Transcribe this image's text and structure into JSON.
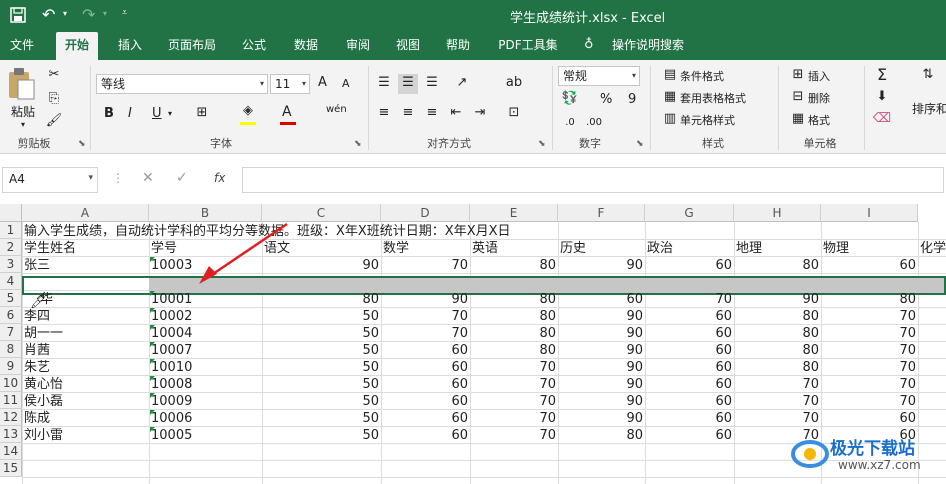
{
  "titlebar": {
    "title": "学生成绩统计.xlsx  -  Excel",
    "quick_access": {
      "save": "save-icon",
      "undo": "undo-icon",
      "redo": "redo-icon",
      "customize": "customize-icon"
    },
    "brand_color": "#217346"
  },
  "tabs": [
    "文件",
    "开始",
    "插入",
    "页面布局",
    "公式",
    "数据",
    "审阅",
    "视图",
    "帮助",
    "PDF工具集",
    "操作说明搜索"
  ],
  "ribbon": {
    "clipboard": {
      "label": "剪贴板",
      "paste": "粘贴"
    },
    "font": {
      "label": "字体",
      "font_name": "等线",
      "font_size": "11",
      "bold": "B",
      "italic": "I",
      "underline": "U",
      "grow": "A",
      "shrink": "A",
      "phonetic": "wén"
    },
    "alignment": {
      "label": "对齐方式"
    },
    "number": {
      "label": "数字",
      "format": "常规",
      "percent": "%",
      "comma": "9"
    },
    "styles": {
      "label": "样式",
      "conditional": "条件格式",
      "table": "套用表格格式",
      "cell_styles": "单元格样式"
    },
    "cells": {
      "label": "单元格",
      "insert": "插入",
      "delete": "删除",
      "format": "格式"
    },
    "editing": {
      "sort": "排序和"
    }
  },
  "formula_bar": {
    "name_box": "A4",
    "fx": "fx",
    "content": ""
  },
  "columns": [
    "A",
    "B",
    "C",
    "D",
    "E",
    "F",
    "G",
    "H",
    "I"
  ],
  "rows": [
    "1",
    "2",
    "3",
    "4",
    "5",
    "6",
    "7",
    "8",
    "9",
    "10",
    "11",
    "12",
    "13",
    "14",
    "15"
  ],
  "sheet": {
    "row1": "输入学生成绩，自动统计学科的平均分等数据。班级：X年X班统计日期：X年X月X日",
    "headers": [
      "学生姓名",
      "学号",
      "语文",
      "数学",
      "英语",
      "历史",
      "政治",
      "地理",
      "物理",
      "化学"
    ],
    "records": [
      {
        "name": "张三",
        "id": "10003",
        "scores": [
          "90",
          "70",
          "80",
          "90",
          "60",
          "80",
          "60"
        ]
      },
      {
        "name": "华",
        "id": "10001",
        "scores": [
          "80",
          "90",
          "80",
          "60",
          "70",
          "90",
          "80"
        ]
      },
      {
        "name": "李四",
        "id": "10002",
        "scores": [
          "50",
          "70",
          "80",
          "90",
          "60",
          "80",
          "70"
        ]
      },
      {
        "name": "胡一一",
        "id": "10004",
        "scores": [
          "50",
          "70",
          "80",
          "90",
          "60",
          "80",
          "70"
        ]
      },
      {
        "name": "肖茜",
        "id": "10007",
        "scores": [
          "50",
          "60",
          "80",
          "90",
          "60",
          "80",
          "70"
        ]
      },
      {
        "name": "朱艺",
        "id": "10010",
        "scores": [
          "50",
          "60",
          "70",
          "90",
          "60",
          "80",
          "70"
        ]
      },
      {
        "name": "黄心怡",
        "id": "10008",
        "scores": [
          "50",
          "60",
          "70",
          "90",
          "60",
          "70",
          "70"
        ]
      },
      {
        "name": "侯小磊",
        "id": "10009",
        "scores": [
          "50",
          "60",
          "70",
          "90",
          "60",
          "70",
          "70"
        ]
      },
      {
        "name": "陈成",
        "id": "10006",
        "scores": [
          "50",
          "60",
          "70",
          "90",
          "60",
          "70",
          "60"
        ]
      },
      {
        "name": "刘小雷",
        "id": "10005",
        "scores": [
          "50",
          "60",
          "70",
          "80",
          "60",
          "70",
          "60"
        ]
      }
    ]
  },
  "watermark": {
    "name": "极光下载站",
    "url": "www.xz7.com"
  }
}
